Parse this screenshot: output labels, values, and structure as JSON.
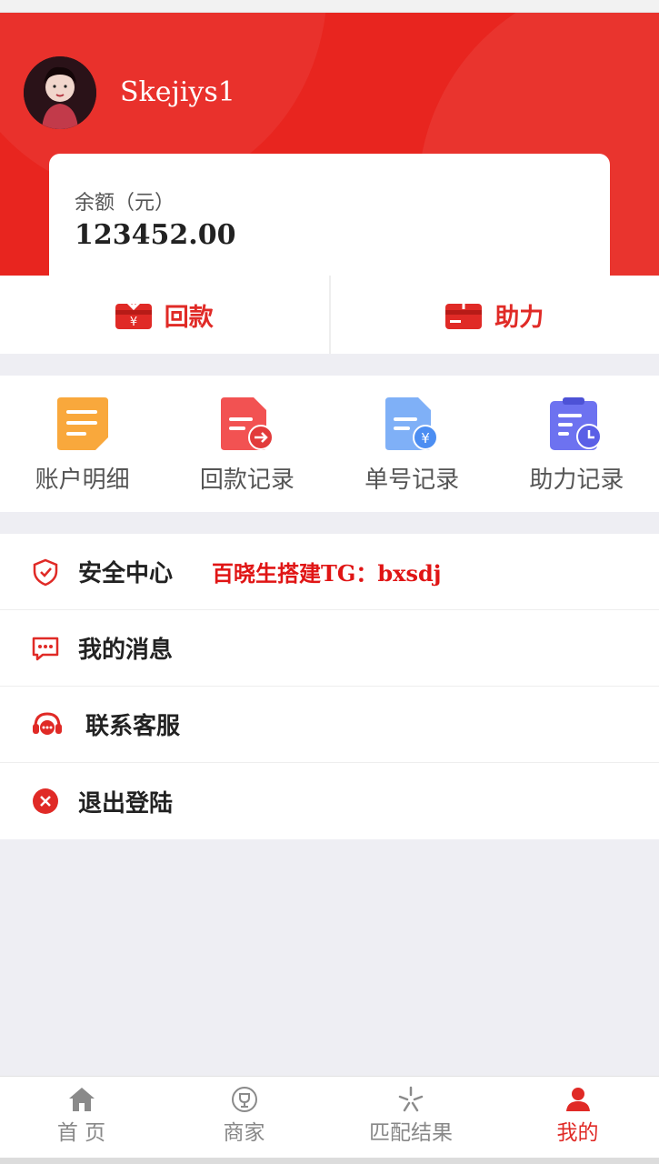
{
  "profile": {
    "username": "Skejiys1"
  },
  "balance": {
    "label": "余额（元）",
    "value": "123452.00"
  },
  "actions": [
    {
      "label": "回款",
      "icon": "wallet-in-icon"
    },
    {
      "label": "助力",
      "icon": "wallet-out-icon"
    }
  ],
  "grid": [
    {
      "label": "账户明细",
      "icon": "account-detail-icon",
      "color": "#f9a83c"
    },
    {
      "label": "回款记录",
      "icon": "payment-record-icon",
      "color": "#f25252"
    },
    {
      "label": "单号记录",
      "icon": "order-record-icon",
      "color": "#5b9cf5"
    },
    {
      "label": "助力记录",
      "icon": "assist-record-icon",
      "color": "#6d72f0"
    }
  ],
  "menu": [
    {
      "label": "安全中心",
      "icon": "shield-icon"
    },
    {
      "label": "我的消息",
      "icon": "message-icon"
    },
    {
      "label": "联系客服",
      "icon": "headset-icon"
    },
    {
      "label": "退出登陆",
      "icon": "logout-icon"
    }
  ],
  "promo_text": "百晓生搭建TG：bxsdj",
  "tabs": [
    {
      "label": "首 页",
      "icon": "home-icon"
    },
    {
      "label": "商家",
      "icon": "trophy-icon"
    },
    {
      "label": "匹配结果",
      "icon": "match-icon"
    },
    {
      "label": "我的",
      "icon": "user-icon",
      "active": true
    }
  ],
  "colors": {
    "brand_red": "#e8251f",
    "accent_red": "#e02a26",
    "page_bg": "#eeeef3"
  }
}
